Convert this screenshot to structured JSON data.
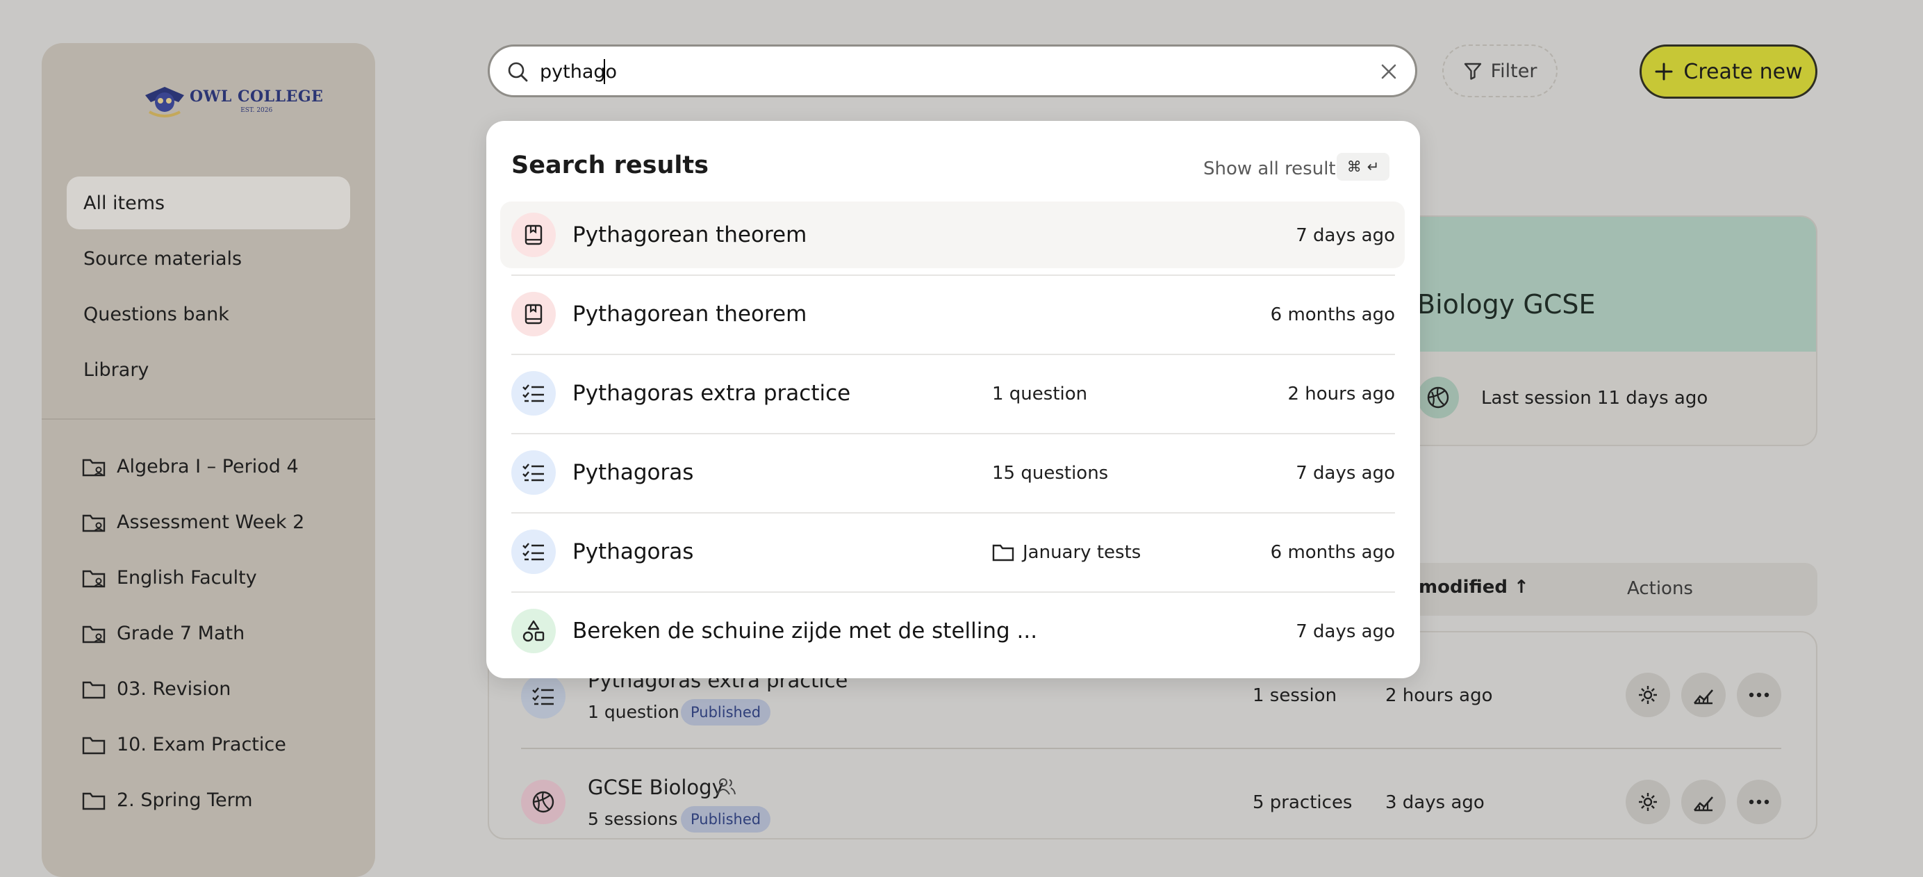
{
  "sidebar": {
    "logo": {
      "name": "OWL COLLEGE",
      "sub": "EST. 2026"
    },
    "nav": [
      "All items",
      "Source materials",
      "Questions bank",
      "Library"
    ],
    "folders": [
      {
        "label": "Algebra I – Period 4",
        "shared": true
      },
      {
        "label": "Assessment Week 2",
        "shared": true
      },
      {
        "label": "English Faculty",
        "shared": true
      },
      {
        "label": "Grade 7 Math",
        "shared": true
      },
      {
        "label": "03. Revision",
        "shared": false
      },
      {
        "label": "10. Exam Practice",
        "shared": false
      },
      {
        "label": "2. Spring Term",
        "shared": false
      }
    ]
  },
  "topbar": {
    "search_value": "pythago",
    "filter_label": "Filter",
    "create_label": "Create new"
  },
  "search_results": {
    "title": "Search results",
    "show_all": "Show all results",
    "shortcut": [
      "⌘",
      "↵"
    ],
    "items": [
      {
        "title": "Pythagorean theorem",
        "meta": "",
        "time": "7 days ago",
        "icon": "book-icon",
        "icon_bg": "#fbe3e3"
      },
      {
        "title": "Pythagorean theorem",
        "meta": "",
        "time": "6 months ago",
        "icon": "book-icon",
        "icon_bg": "#fbe3e3"
      },
      {
        "title": "Pythagoras extra practice",
        "meta": "1 question",
        "time": "2 hours ago",
        "icon": "checklist-icon",
        "icon_bg": "#e2ecfb"
      },
      {
        "title": "Pythagoras",
        "meta": "15 questions",
        "time": "7 days ago",
        "icon": "checklist-icon",
        "icon_bg": "#e2ecfb"
      },
      {
        "title": "Pythagoras",
        "meta": "January tests",
        "time": "6 months ago",
        "icon": "checklist-icon",
        "icon_bg": "#e2ecfb"
      },
      {
        "title": "Bereken de schuine zijde met de stelling ...",
        "meta": "",
        "time": "7 days ago",
        "icon": "shapes-icon",
        "icon_bg": "#def3e2"
      }
    ]
  },
  "background": {
    "card": {
      "title": "Biology GCSE",
      "meta": "Last session 11 days ago"
    },
    "table_header": {
      "modified": "modified",
      "actions": "Actions"
    },
    "rows": [
      {
        "title": "Pythagoras extra practice",
        "sub": "1 question",
        "badge": "Published",
        "count": "1 session",
        "time": "2 hours ago"
      },
      {
        "title": "GCSE Biology",
        "sub": "5 sessions",
        "badge": "Published",
        "count": "5 practices",
        "time": "3 days ago"
      }
    ]
  },
  "colors": {
    "accent": "#c7c736",
    "badge_text": "#2f3f7a"
  }
}
